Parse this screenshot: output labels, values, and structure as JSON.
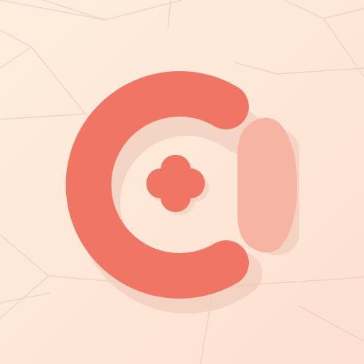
{
  "icon": {
    "name": "health-plus-app-icon",
    "glyph": "plus-icon",
    "colors": {
      "background_top": "#FEEEDD",
      "background_bottom": "#FDE0D2",
      "mesh_lines": "#E8BFB0",
      "shadow": "#EFC8B8",
      "primary": "#F07565",
      "secondary": "#F6B5A3"
    }
  }
}
